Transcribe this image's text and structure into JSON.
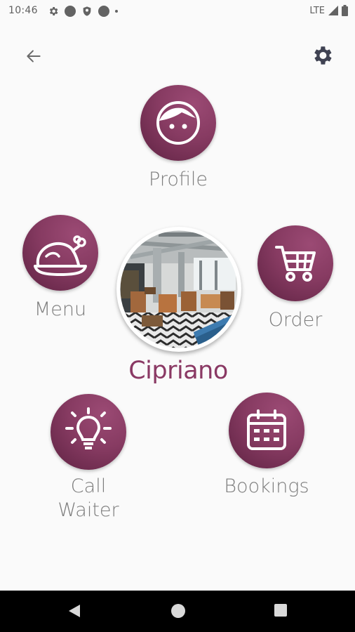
{
  "status_bar": {
    "time": "10:46",
    "network": "LTE",
    "icons": [
      "settings-icon",
      "circle-icon",
      "shield-icon",
      "circle-icon",
      "dot-icon",
      "signal-icon",
      "battery-icon"
    ]
  },
  "app_bar": {
    "back_icon": "arrow-left-icon",
    "settings_icon": "gear-icon"
  },
  "restaurant": {
    "name": "Cipriano"
  },
  "menu_items": {
    "profile": {
      "label": "Profile",
      "icon": "face-icon"
    },
    "menu": {
      "label": "Menu",
      "icon": "roast-chicken-icon"
    },
    "order": {
      "label": "Order",
      "icon": "shopping-cart-icon"
    },
    "call_waiter_line1": "Call",
    "call_waiter_line2": "Waiter",
    "call_waiter_icon": "lightbulb-icon",
    "bookings": {
      "label": "Bookings",
      "icon": "calendar-icon"
    }
  },
  "nav_bar": {
    "icons": [
      "back-triangle-icon",
      "home-circle-icon",
      "recents-square-icon"
    ]
  },
  "colors": {
    "accent": "#873b62",
    "accent_dark": "#5e2242",
    "label": "#7c7c7c",
    "background": "#fafafa"
  }
}
